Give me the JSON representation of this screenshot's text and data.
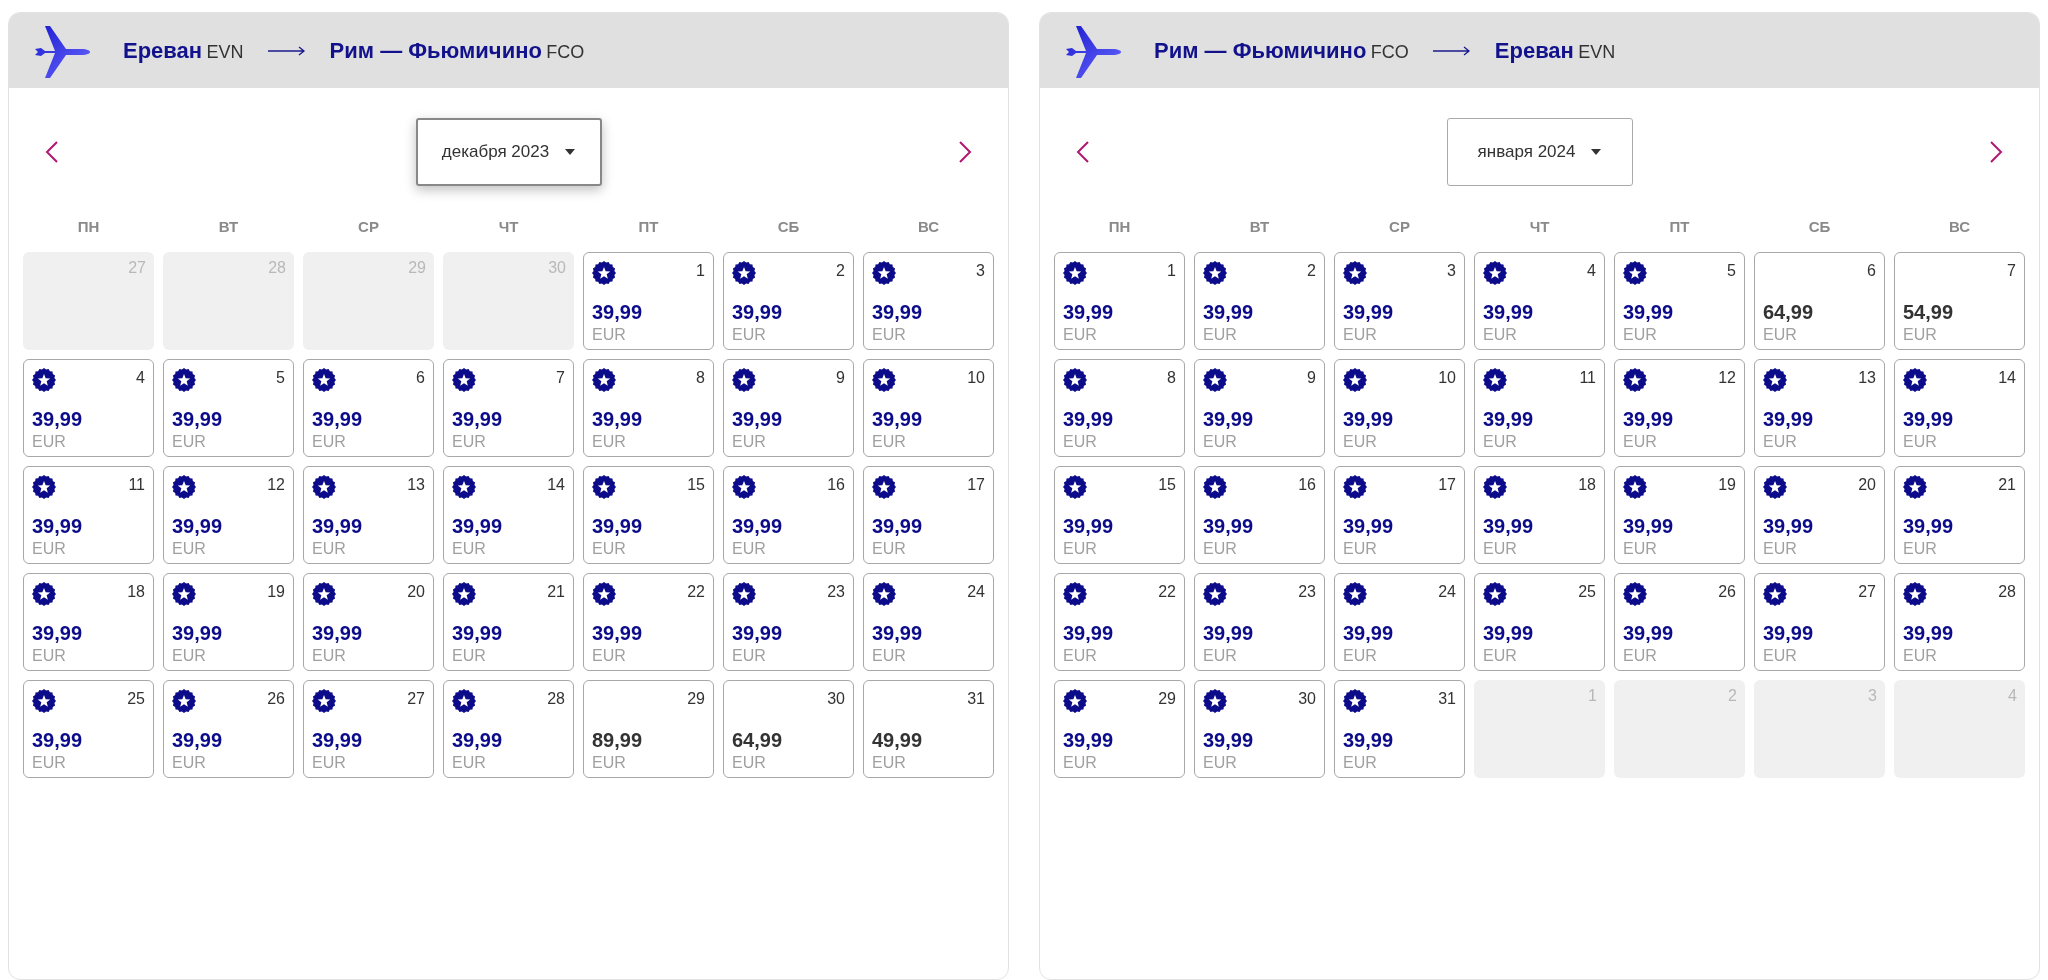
{
  "panels": [
    {
      "origin": {
        "city": "Ереван",
        "code": "EVN"
      },
      "destination": {
        "city": "Рим — Фьюмичино",
        "code": "FCO"
      },
      "month": {
        "label": "декабря 2023",
        "focused": true
      },
      "weekdays": [
        "ПН",
        "ВТ",
        "СР",
        "ЧТ",
        "ПТ",
        "СБ",
        "ВС"
      ],
      "days": [
        {
          "day": "27",
          "kind": "outside"
        },
        {
          "day": "28",
          "kind": "outside"
        },
        {
          "day": "29",
          "kind": "outside"
        },
        {
          "day": "30",
          "kind": "outside"
        },
        {
          "day": "1",
          "kind": "promo",
          "price": "39,99",
          "currency": "EUR"
        },
        {
          "day": "2",
          "kind": "promo",
          "price": "39,99",
          "currency": "EUR"
        },
        {
          "day": "3",
          "kind": "promo",
          "price": "39,99",
          "currency": "EUR"
        },
        {
          "day": "4",
          "kind": "promo",
          "price": "39,99",
          "currency": "EUR"
        },
        {
          "day": "5",
          "kind": "promo",
          "price": "39,99",
          "currency": "EUR"
        },
        {
          "day": "6",
          "kind": "promo",
          "price": "39,99",
          "currency": "EUR"
        },
        {
          "day": "7",
          "kind": "promo",
          "price": "39,99",
          "currency": "EUR"
        },
        {
          "day": "8",
          "kind": "promo",
          "price": "39,99",
          "currency": "EUR"
        },
        {
          "day": "9",
          "kind": "promo",
          "price": "39,99",
          "currency": "EUR"
        },
        {
          "day": "10",
          "kind": "promo",
          "price": "39,99",
          "currency": "EUR"
        },
        {
          "day": "11",
          "kind": "promo",
          "price": "39,99",
          "currency": "EUR"
        },
        {
          "day": "12",
          "kind": "promo",
          "price": "39,99",
          "currency": "EUR"
        },
        {
          "day": "13",
          "kind": "promo",
          "price": "39,99",
          "currency": "EUR"
        },
        {
          "day": "14",
          "kind": "promo",
          "price": "39,99",
          "currency": "EUR"
        },
        {
          "day": "15",
          "kind": "promo",
          "price": "39,99",
          "currency": "EUR"
        },
        {
          "day": "16",
          "kind": "promo",
          "price": "39,99",
          "currency": "EUR"
        },
        {
          "day": "17",
          "kind": "promo",
          "price": "39,99",
          "currency": "EUR"
        },
        {
          "day": "18",
          "kind": "promo",
          "price": "39,99",
          "currency": "EUR"
        },
        {
          "day": "19",
          "kind": "promo",
          "price": "39,99",
          "currency": "EUR"
        },
        {
          "day": "20",
          "kind": "promo",
          "price": "39,99",
          "currency": "EUR"
        },
        {
          "day": "21",
          "kind": "promo",
          "price": "39,99",
          "currency": "EUR"
        },
        {
          "day": "22",
          "kind": "promo",
          "price": "39,99",
          "currency": "EUR"
        },
        {
          "day": "23",
          "kind": "promo",
          "price": "39,99",
          "currency": "EUR"
        },
        {
          "day": "24",
          "kind": "promo",
          "price": "39,99",
          "currency": "EUR"
        },
        {
          "day": "25",
          "kind": "promo",
          "price": "39,99",
          "currency": "EUR"
        },
        {
          "day": "26",
          "kind": "promo",
          "price": "39,99",
          "currency": "EUR"
        },
        {
          "day": "27",
          "kind": "promo",
          "price": "39,99",
          "currency": "EUR"
        },
        {
          "day": "28",
          "kind": "promo",
          "price": "39,99",
          "currency": "EUR"
        },
        {
          "day": "29",
          "kind": "regular",
          "price": "89,99",
          "currency": "EUR"
        },
        {
          "day": "30",
          "kind": "regular",
          "price": "64,99",
          "currency": "EUR"
        },
        {
          "day": "31",
          "kind": "regular",
          "price": "49,99",
          "currency": "EUR"
        }
      ]
    },
    {
      "origin": {
        "city": "Рим — Фьюмичино",
        "code": "FCO"
      },
      "destination": {
        "city": "Ереван",
        "code": "EVN"
      },
      "month": {
        "label": "января 2024",
        "focused": false
      },
      "weekdays": [
        "ПН",
        "ВТ",
        "СР",
        "ЧТ",
        "ПТ",
        "СБ",
        "ВС"
      ],
      "days": [
        {
          "day": "1",
          "kind": "promo",
          "price": "39,99",
          "currency": "EUR"
        },
        {
          "day": "2",
          "kind": "promo",
          "price": "39,99",
          "currency": "EUR"
        },
        {
          "day": "3",
          "kind": "promo",
          "price": "39,99",
          "currency": "EUR"
        },
        {
          "day": "4",
          "kind": "promo",
          "price": "39,99",
          "currency": "EUR"
        },
        {
          "day": "5",
          "kind": "promo",
          "price": "39,99",
          "currency": "EUR"
        },
        {
          "day": "6",
          "kind": "regular",
          "price": "64,99",
          "currency": "EUR"
        },
        {
          "day": "7",
          "kind": "regular",
          "price": "54,99",
          "currency": "EUR"
        },
        {
          "day": "8",
          "kind": "promo",
          "price": "39,99",
          "currency": "EUR"
        },
        {
          "day": "9",
          "kind": "promo",
          "price": "39,99",
          "currency": "EUR"
        },
        {
          "day": "10",
          "kind": "promo",
          "price": "39,99",
          "currency": "EUR"
        },
        {
          "day": "11",
          "kind": "promo",
          "price": "39,99",
          "currency": "EUR"
        },
        {
          "day": "12",
          "kind": "promo",
          "price": "39,99",
          "currency": "EUR"
        },
        {
          "day": "13",
          "kind": "promo",
          "price": "39,99",
          "currency": "EUR"
        },
        {
          "day": "14",
          "kind": "promo",
          "price": "39,99",
          "currency": "EUR"
        },
        {
          "day": "15",
          "kind": "promo",
          "price": "39,99",
          "currency": "EUR"
        },
        {
          "day": "16",
          "kind": "promo",
          "price": "39,99",
          "currency": "EUR"
        },
        {
          "day": "17",
          "kind": "promo",
          "price": "39,99",
          "currency": "EUR"
        },
        {
          "day": "18",
          "kind": "promo",
          "price": "39,99",
          "currency": "EUR"
        },
        {
          "day": "19",
          "kind": "promo",
          "price": "39,99",
          "currency": "EUR"
        },
        {
          "day": "20",
          "kind": "promo",
          "price": "39,99",
          "currency": "EUR"
        },
        {
          "day": "21",
          "kind": "promo",
          "price": "39,99",
          "currency": "EUR"
        },
        {
          "day": "22",
          "kind": "promo",
          "price": "39,99",
          "currency": "EUR"
        },
        {
          "day": "23",
          "kind": "promo",
          "price": "39,99",
          "currency": "EUR"
        },
        {
          "day": "24",
          "kind": "promo",
          "price": "39,99",
          "currency": "EUR"
        },
        {
          "day": "25",
          "kind": "promo",
          "price": "39,99",
          "currency": "EUR"
        },
        {
          "day": "26",
          "kind": "promo",
          "price": "39,99",
          "currency": "EUR"
        },
        {
          "day": "27",
          "kind": "promo",
          "price": "39,99",
          "currency": "EUR"
        },
        {
          "day": "28",
          "kind": "promo",
          "price": "39,99",
          "currency": "EUR"
        },
        {
          "day": "29",
          "kind": "promo",
          "price": "39,99",
          "currency": "EUR"
        },
        {
          "day": "30",
          "kind": "promo",
          "price": "39,99",
          "currency": "EUR"
        },
        {
          "day": "31",
          "kind": "promo",
          "price": "39,99",
          "currency": "EUR"
        },
        {
          "day": "1",
          "kind": "outside"
        },
        {
          "day": "2",
          "kind": "outside"
        },
        {
          "day": "3",
          "kind": "outside"
        },
        {
          "day": "4",
          "kind": "outside"
        }
      ]
    }
  ]
}
